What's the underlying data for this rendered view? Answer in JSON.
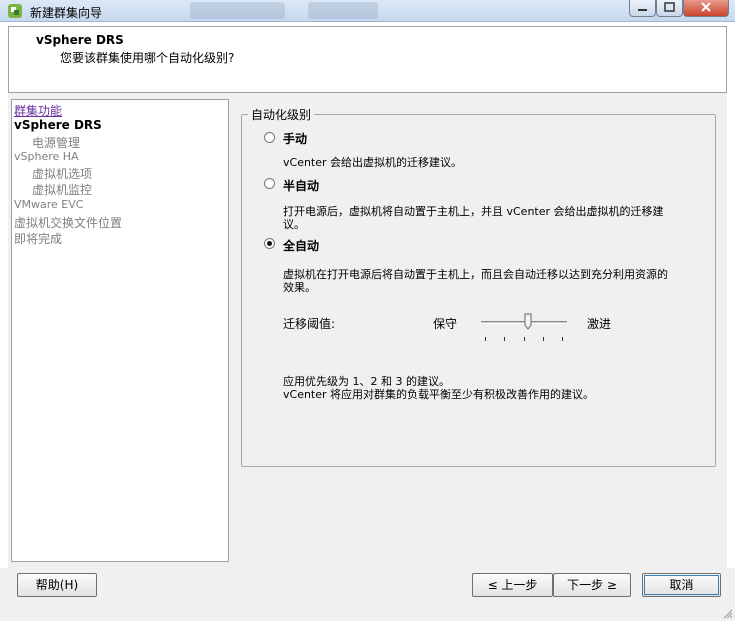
{
  "window": {
    "title": "新建群集向导",
    "background_tabs": [
      "",
      ""
    ]
  },
  "header": {
    "title": "vSphere DRS",
    "subtitle": "您要该群集使用哪个自动化级别?"
  },
  "nav": {
    "items": [
      {
        "label": "群集功能"
      },
      {
        "label": "vSphere DRS"
      },
      {
        "label": "电源管理"
      },
      {
        "label": "vSphere HA"
      },
      {
        "label": "虚拟机选项"
      },
      {
        "label": "虚拟机监控"
      },
      {
        "label": "VMware EVC"
      },
      {
        "label": "虚拟机交换文件位置"
      },
      {
        "label": "即将完成"
      }
    ]
  },
  "automation": {
    "group_label": "自动化级别",
    "options": [
      {
        "label": "手动",
        "description": "vCenter 会给出虚拟机的迁移建议。",
        "selected": false
      },
      {
        "label": "半自动",
        "description": "打开电源后，虚拟机将自动置于主机上，并且 vCenter 会给出虚拟机的迁移建",
        "description_line2": "议。",
        "selected": false
      },
      {
        "label": "全自动",
        "description": "虚拟机在打开电源后将自动置于主机上，而且会自动迁移以达到充分利用资源的",
        "description_line2": "效果。",
        "selected": true
      }
    ],
    "threshold": {
      "label": "迁移阈值:",
      "left_label": "保守",
      "right_label": "激进",
      "level": 3,
      "levels": 5
    },
    "info_line1": "应用优先级为 1、2 和 3 的建议。",
    "info_line2": "vCenter 将应用对群集的负载平衡至少有积极改善作用的建议。"
  },
  "footer": {
    "help": "帮助(H)",
    "back": "≤ 上一步",
    "next": "下一步 ≥",
    "cancel": "取消"
  }
}
